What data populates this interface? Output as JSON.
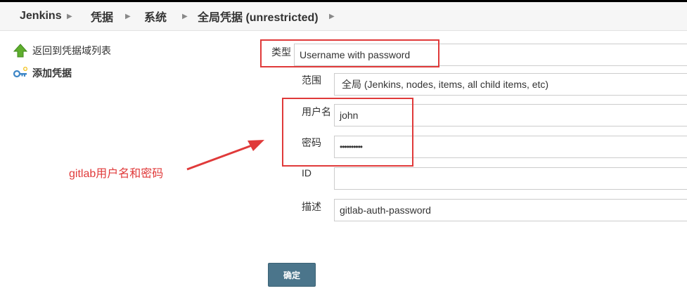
{
  "breadcrumb": {
    "items": [
      "Jenkins",
      "凭据",
      "系统",
      "全局凭据 (unrestricted)"
    ]
  },
  "sidebar": {
    "items": [
      {
        "label": "返回到凭据域列表",
        "icon": "up-arrow-icon"
      },
      {
        "label": "添加凭据",
        "icon": "key-add-icon"
      }
    ]
  },
  "form": {
    "kind_label": "类型",
    "kind_value": "Username with password",
    "scope_label": "范围",
    "scope_value": "全局 (Jenkins, nodes, items, all child items, etc)",
    "username_label": "用户名",
    "username_value": "john",
    "password_label": "密码",
    "password_value": "••••••••••",
    "id_label": "ID",
    "id_value": "",
    "description_label": "描述",
    "description_value": "gitlab-auth-password",
    "ok_label": "确定"
  },
  "annotation": {
    "text": "gitlab用户名和密码",
    "color": "#e03a3a"
  },
  "colors": {
    "button": "#4b758b",
    "highlight": "#e03a3a"
  }
}
